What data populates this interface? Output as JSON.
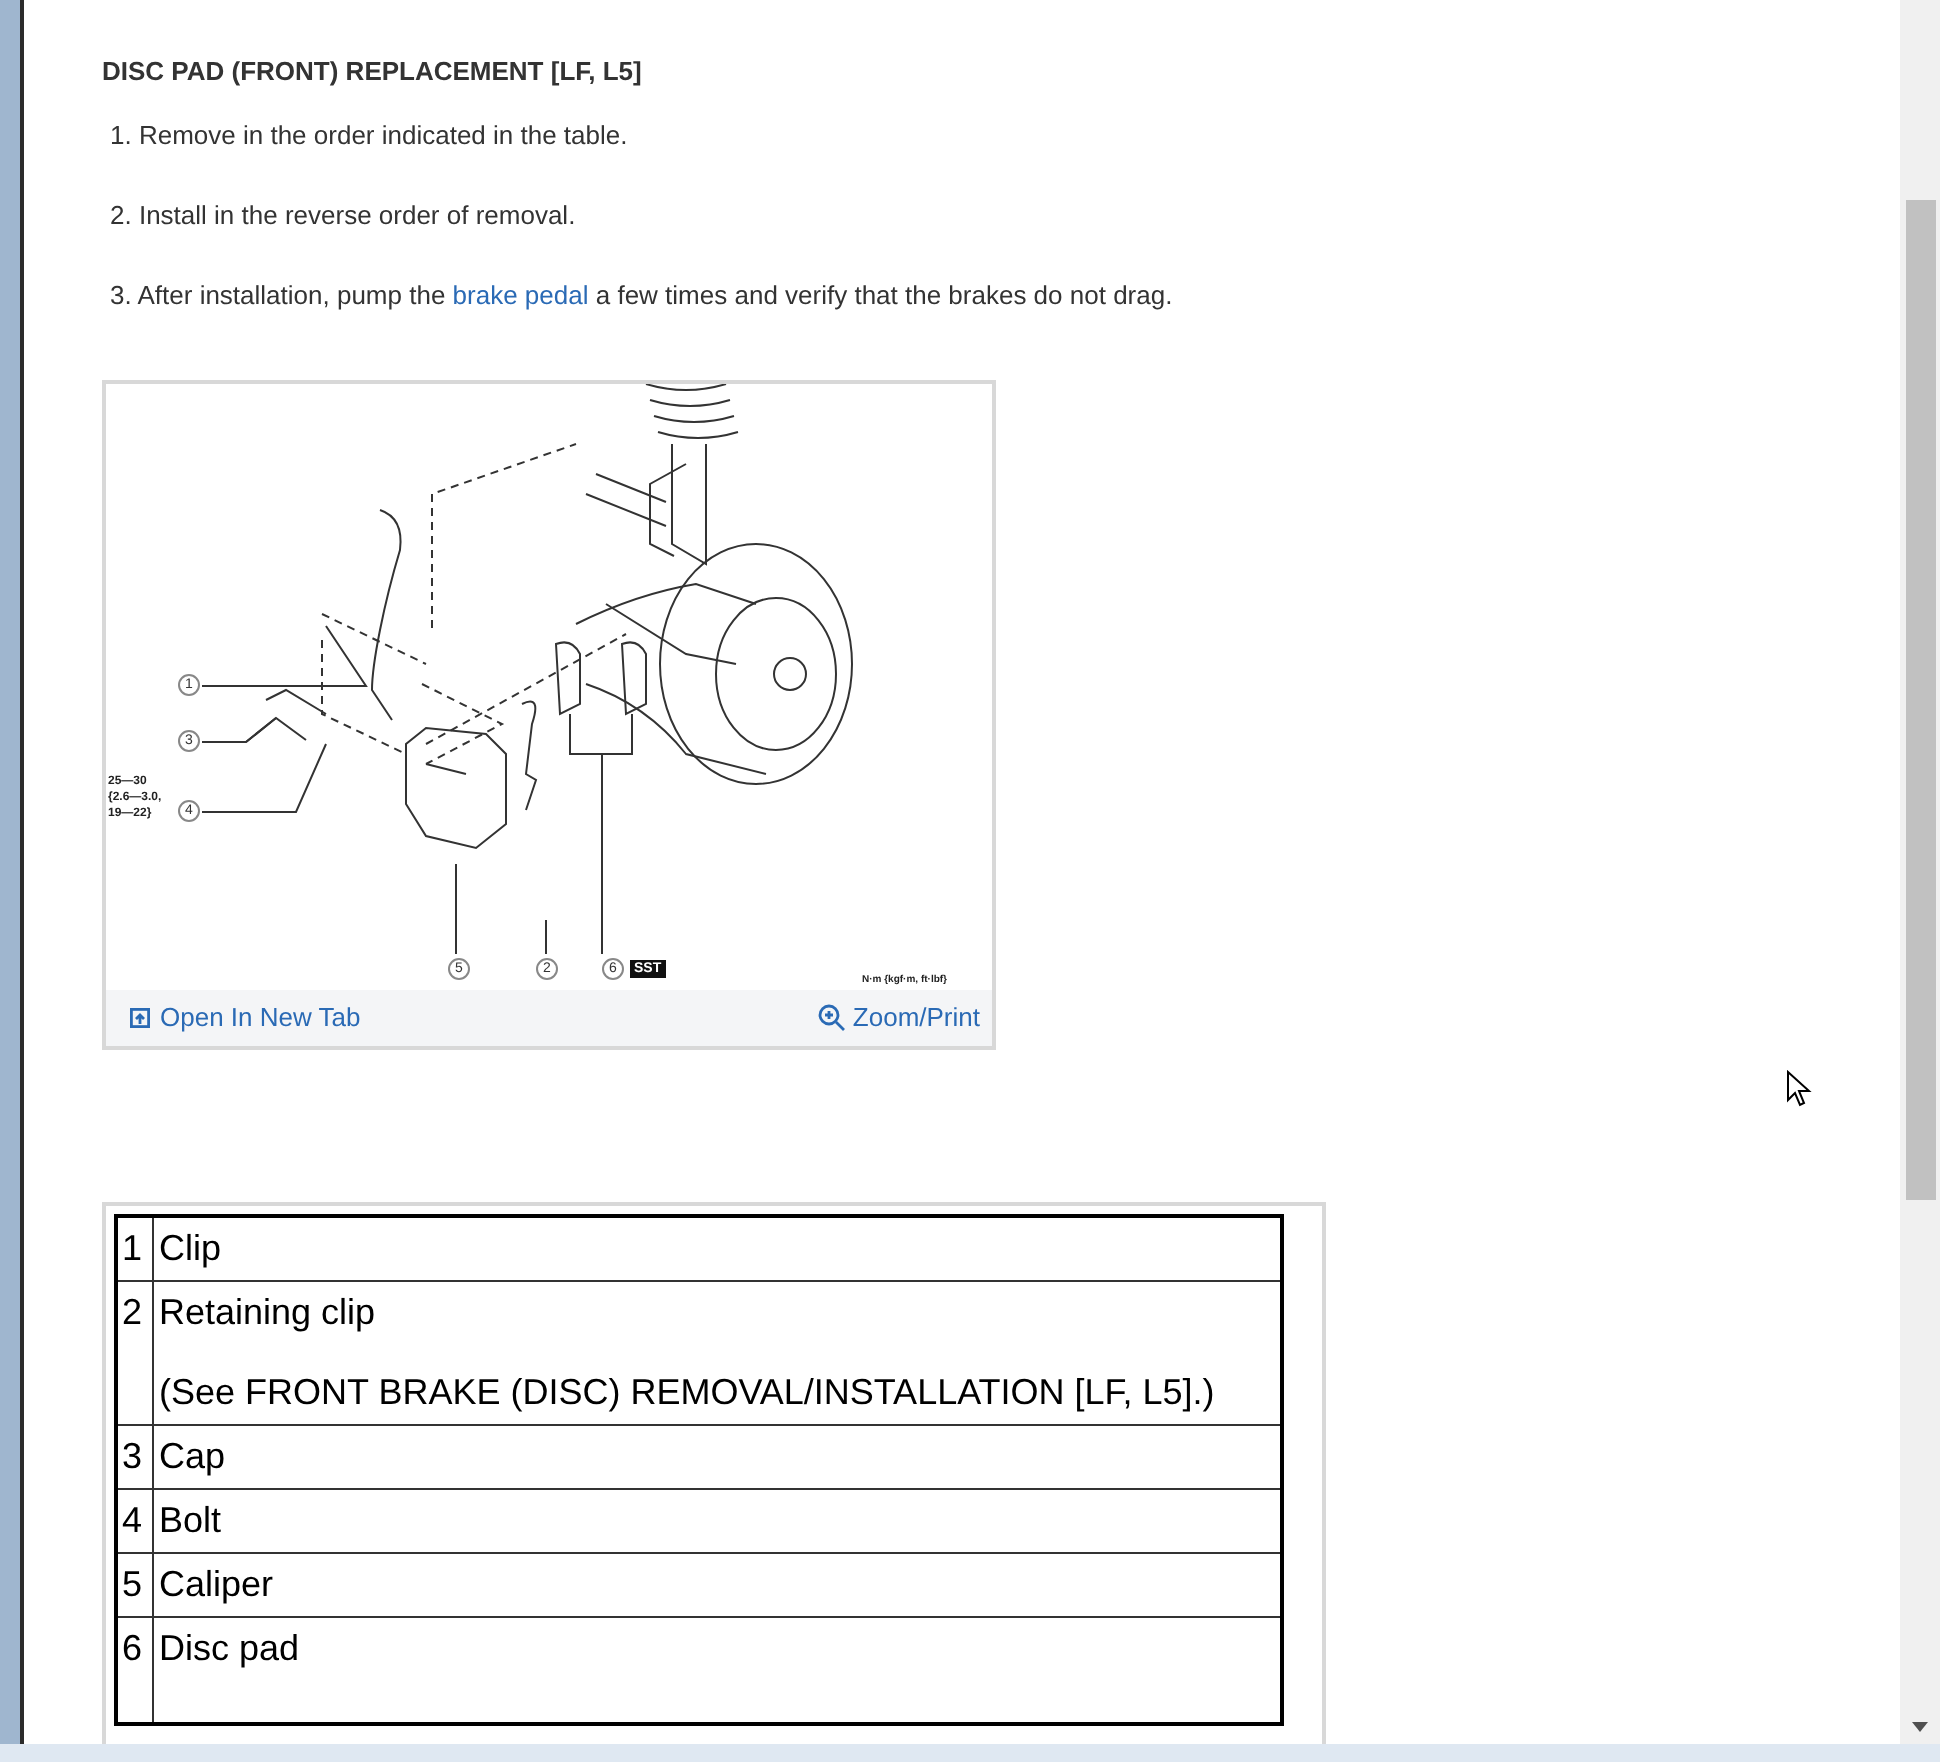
{
  "heading": "DISC PAD (FRONT) REPLACEMENT [LF, L5]",
  "steps": [
    {
      "number": "1.",
      "parts": [
        {
          "kind": "text",
          "text": "Remove in the order indicated in the table."
        }
      ]
    },
    {
      "number": "2.",
      "parts": [
        {
          "kind": "text",
          "text": "Install in the reverse order of removal."
        }
      ]
    },
    {
      "number": "3.",
      "parts": [
        {
          "kind": "text",
          "text": "After installation, pump the"
        },
        {
          "kind": "link",
          "text": "brake pedal"
        },
        {
          "kind": "text",
          "text": "a few times and verify that the brakes do not drag."
        }
      ]
    }
  ],
  "figure": {
    "callouts": [
      "1",
      "3",
      "4",
      "5",
      "2",
      "6"
    ],
    "torque": [
      "25—30",
      "{2.6—3.0,",
      "19—22}"
    ],
    "tool_tag": "SST",
    "units": "N·m {kgf·m, ft·lbf}",
    "open_link": "Open In New Tab",
    "zoom_link": "Zoom/Print"
  },
  "table": {
    "rows": [
      {
        "number": "1",
        "name": "Clip"
      },
      {
        "number": "2",
        "name": "Retaining clip",
        "note": "(See FRONT BRAKE (DISC) REMOVAL/INSTALLATION [LF, L5].)"
      },
      {
        "number": "3",
        "name": "Cap"
      },
      {
        "number": "4",
        "name": "Bolt"
      },
      {
        "number": "5",
        "name": "Caliper"
      },
      {
        "number": "6",
        "name": "Disc pad"
      }
    ]
  }
}
